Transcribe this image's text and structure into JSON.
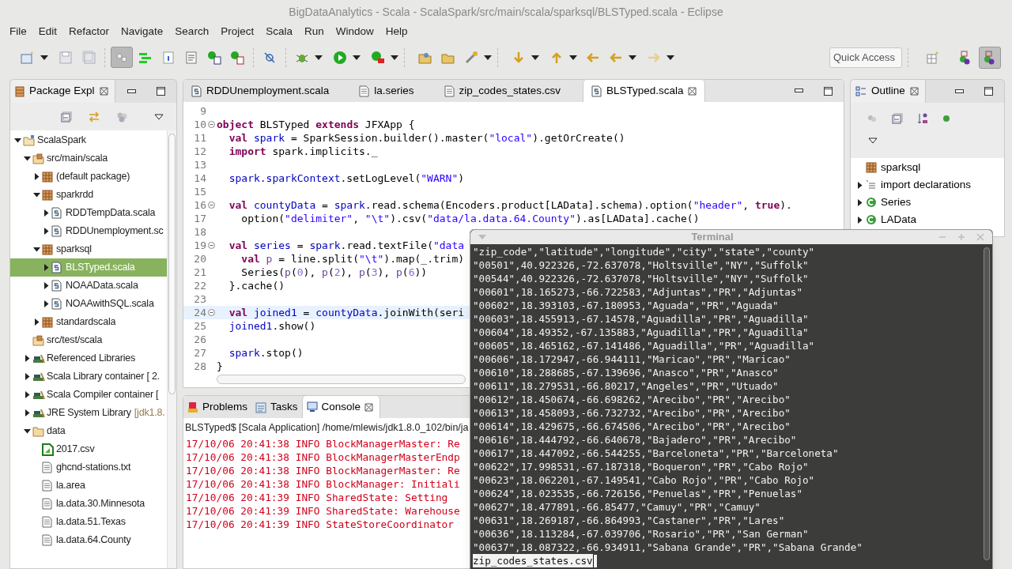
{
  "window": {
    "title": "BigDataAnalytics - Scala - ScalaSpark/src/main/scala/sparksql/BLSTyped.scala - Eclipse"
  },
  "menu": [
    "File",
    "Edit",
    "Refactor",
    "Navigate",
    "Search",
    "Project",
    "Scala",
    "Run",
    "Window",
    "Help"
  ],
  "toolbar": {
    "toggle_pressed": true
  },
  "quick_access": {
    "placeholder": "Quick Access"
  },
  "perspectives": [
    {
      "selected": false
    },
    {
      "selected": true
    }
  ],
  "package_explorer": {
    "tab": "Package Expl",
    "tree": [
      {
        "label": "ScalaSpark",
        "kind": "project",
        "expanded": true,
        "selected": false,
        "children": [
          {
            "label": "src/main/scala",
            "kind": "srcfolder",
            "expanded": true,
            "selected": false,
            "children": [
              {
                "label": "(default package)",
                "kind": "package",
                "expanded": false,
                "selected": false
              },
              {
                "label": "sparkrdd",
                "kind": "package",
                "expanded": true,
                "selected": false,
                "children": [
                  {
                    "label": "RDDTempData.scala",
                    "kind": "scala",
                    "expanded": false,
                    "selected": false
                  },
                  {
                    "label": "RDDUnemployment.sc",
                    "kind": "scala",
                    "expanded": false,
                    "selected": false
                  }
                ]
              },
              {
                "label": "sparksql",
                "kind": "package",
                "expanded": true,
                "selected": false,
                "children": [
                  {
                    "label": "BLSTyped.scala",
                    "kind": "scala",
                    "expanded": false,
                    "selected": true
                  },
                  {
                    "label": "NOAAData.scala",
                    "kind": "scala",
                    "expanded": false,
                    "selected": false
                  },
                  {
                    "label": "NOAAwithSQL.scala",
                    "kind": "scala",
                    "expanded": false,
                    "selected": false
                  }
                ]
              },
              {
                "label": "standardscala",
                "kind": "package",
                "expanded": false,
                "selected": false
              }
            ]
          },
          {
            "label": "src/test/scala",
            "kind": "srcfolder",
            "selected": false
          },
          {
            "label": "Referenced Libraries",
            "kind": "library",
            "expanded": false,
            "selected": false
          },
          {
            "label": "Scala Library container [ 2.",
            "kind": "library",
            "expanded": false,
            "selected": false
          },
          {
            "label": "Scala Compiler container [",
            "kind": "library",
            "expanded": false,
            "selected": false
          },
          {
            "label": "JRE System Library",
            "note": "[jdk1.8.",
            "kind": "library",
            "expanded": false,
            "selected": false
          },
          {
            "label": "data",
            "kind": "folder",
            "expanded": true,
            "selected": false,
            "children": [
              {
                "label": "2017.csv",
                "kind": "csv",
                "selected": false
              },
              {
                "label": "ghcnd-stations.txt",
                "kind": "file",
                "selected": false
              },
              {
                "label": "la.area",
                "kind": "file",
                "selected": false
              },
              {
                "label": "la.data.30.Minnesota",
                "kind": "file",
                "selected": false
              },
              {
                "label": "la.data.51.Texas",
                "kind": "file",
                "selected": false
              },
              {
                "label": "la.data.64.County",
                "kind": "file",
                "selected": false
              }
            ]
          }
        ]
      }
    ]
  },
  "editor": {
    "tabs": [
      {
        "label": "RDDUnemployment.scala",
        "kind": "scala",
        "selected": false
      },
      {
        "label": "la.series",
        "kind": "file",
        "selected": false
      },
      {
        "label": "zip_codes_states.csv",
        "kind": "file",
        "selected": false
      },
      {
        "label": "BLSTyped.scala",
        "kind": "scala",
        "selected": true
      }
    ],
    "lines": [
      {
        "number": "9",
        "fold": false,
        "current": false
      },
      {
        "number": "10",
        "fold": true,
        "current": false,
        "tokens": [
          {
            "t": "object",
            "kind": "kw"
          },
          {
            "t": " BLSTyped ",
            "kind": "plain"
          },
          {
            "t": "extends",
            "kind": "kw"
          },
          {
            "t": " JFXApp {",
            "kind": "plain"
          }
        ]
      },
      {
        "number": "11",
        "fold": false,
        "current": false,
        "tokens": [
          {
            "t": "  val",
            "kind": "kw"
          },
          {
            "t": " spark",
            "kind": "id"
          },
          {
            "t": " = SparkSession.builder().master(",
            "kind": "plain"
          },
          {
            "t": "\"local\"",
            "kind": "str"
          },
          {
            "t": ").getOrCreate()",
            "kind": "plain"
          }
        ]
      },
      {
        "number": "12",
        "fold": false,
        "current": false,
        "tokens": [
          {
            "t": "  import",
            "kind": "kw"
          },
          {
            "t": " spark.implicits._",
            "kind": "plain"
          }
        ]
      },
      {
        "number": "13",
        "fold": false,
        "current": false
      },
      {
        "number": "14",
        "fold": false,
        "current": false,
        "tokens": [
          {
            "t": "  spark.sparkContext",
            "kind": "id"
          },
          {
            "t": ".setLogLevel(",
            "kind": "plain"
          },
          {
            "t": "\"WARN\"",
            "kind": "str"
          },
          {
            "t": ")",
            "kind": "plain"
          }
        ]
      },
      {
        "number": "15",
        "fold": false,
        "current": false
      },
      {
        "number": "16",
        "fold": true,
        "current": false,
        "tokens": [
          {
            "t": "  val",
            "kind": "kw"
          },
          {
            "t": " countyData",
            "kind": "id"
          },
          {
            "t": " = ",
            "kind": "plain"
          },
          {
            "t": "spark",
            "kind": "id"
          },
          {
            "t": ".read.schema(Encoders.product[LAData].schema).option(",
            "kind": "plain"
          },
          {
            "t": "\"header\"",
            "kind": "str"
          },
          {
            "t": ", ",
            "kind": "plain"
          },
          {
            "t": "true",
            "kind": "kw"
          },
          {
            "t": ").",
            "kind": "plain"
          }
        ]
      },
      {
        "number": "17",
        "fold": false,
        "current": false,
        "tokens": [
          {
            "t": "    option(",
            "kind": "plain"
          },
          {
            "t": "\"delimiter\"",
            "kind": "str"
          },
          {
            "t": ", ",
            "kind": "plain"
          },
          {
            "t": "\"\\t\"",
            "kind": "str"
          },
          {
            "t": ").csv(",
            "kind": "plain"
          },
          {
            "t": "\"data/la.data.64.County\"",
            "kind": "str"
          },
          {
            "t": ").as[LAData].cache()",
            "kind": "plain"
          }
        ]
      },
      {
        "number": "18",
        "fold": false,
        "current": false
      },
      {
        "number": "19",
        "fold": true,
        "current": false,
        "tokens": [
          {
            "t": "  val",
            "kind": "kw"
          },
          {
            "t": " series",
            "kind": "id"
          },
          {
            "t": " = ",
            "kind": "plain"
          },
          {
            "t": "spark",
            "kind": "id"
          },
          {
            "t": ".read.textFile(",
            "kind": "plain"
          },
          {
            "t": "\"data",
            "kind": "str"
          }
        ]
      },
      {
        "number": "20",
        "fold": false,
        "current": false,
        "tokens": [
          {
            "t": "    val",
            "kind": "kw"
          },
          {
            "t": " p",
            "kind": "local"
          },
          {
            "t": " = line.split(",
            "kind": "plain"
          },
          {
            "t": "\"\\t\"",
            "kind": "str"
          },
          {
            "t": ").map(_.trim)",
            "kind": "plain"
          }
        ]
      },
      {
        "number": "21",
        "fold": false,
        "current": false,
        "tokens": [
          {
            "t": "    Series(",
            "kind": "plain"
          },
          {
            "t": "p",
            "kind": "local"
          },
          {
            "t": "(",
            "kind": "plain"
          },
          {
            "t": "0",
            "kind": "num"
          },
          {
            "t": "), ",
            "kind": "plain"
          },
          {
            "t": "p",
            "kind": "local"
          },
          {
            "t": "(",
            "kind": "plain"
          },
          {
            "t": "2",
            "kind": "num"
          },
          {
            "t": "), ",
            "kind": "plain"
          },
          {
            "t": "p",
            "kind": "local"
          },
          {
            "t": "(",
            "kind": "plain"
          },
          {
            "t": "3",
            "kind": "num"
          },
          {
            "t": "), ",
            "kind": "plain"
          },
          {
            "t": "p",
            "kind": "local"
          },
          {
            "t": "(",
            "kind": "plain"
          },
          {
            "t": "6",
            "kind": "num"
          },
          {
            "t": "))",
            "kind": "plain"
          }
        ]
      },
      {
        "number": "22",
        "fold": false,
        "current": false,
        "tokens": [
          {
            "t": "  }.cache()",
            "kind": "plain"
          }
        ]
      },
      {
        "number": "23",
        "fold": false,
        "current": false
      },
      {
        "number": "24",
        "fold": true,
        "current": true,
        "tokens": [
          {
            "t": "  val",
            "kind": "kw"
          },
          {
            "t": " joined1",
            "kind": "id"
          },
          {
            "t": " = ",
            "kind": "plain"
          },
          {
            "t": "countyData",
            "kind": "id"
          },
          {
            "t": ".joinWith(seri",
            "kind": "plain"
          }
        ]
      },
      {
        "number": "25",
        "fold": false,
        "current": false,
        "tokens": [
          {
            "t": "  joined1",
            "kind": "id"
          },
          {
            "t": ".show()",
            "kind": "plain"
          }
        ]
      },
      {
        "number": "26",
        "fold": false,
        "current": false
      },
      {
        "number": "27",
        "fold": false,
        "current": false,
        "tokens": [
          {
            "t": "  spark",
            "kind": "id"
          },
          {
            "t": ".stop()",
            "kind": "plain"
          }
        ]
      },
      {
        "number": "28",
        "fold": false,
        "current": false,
        "tokens": [
          {
            "t": "}",
            "kind": "plain"
          }
        ]
      }
    ]
  },
  "console": {
    "tabs": [
      {
        "label": "Problems",
        "kind": "problems",
        "selected": false
      },
      {
        "label": "Tasks",
        "kind": "tasks",
        "selected": false
      },
      {
        "label": "Console",
        "kind": "console",
        "selected": true
      }
    ],
    "header": "BLSTyped$ [Scala Application] /home/mlewis/jdk1.8.0_102/bin/ja",
    "lines": [
      "17/10/06 20:41:38 INFO BlockManagerMaster: Re",
      "17/10/06 20:41:38 INFO BlockManagerMasterEndp",
      "17/10/06 20:41:38 INFO BlockManagerMaster: Re",
      "17/10/06 20:41:38 INFO BlockManager: Initiali",
      "17/10/06 20:41:39 INFO SharedState: Setting",
      "17/10/06 20:41:39 INFO SharedState: Warehouse",
      "17/10/06 20:41:39 INFO StateStoreCoordinator"
    ]
  },
  "outline": {
    "tab": "Outline",
    "items": [
      {
        "label": "sparksql",
        "kind": "package"
      },
      {
        "label": "import declarations",
        "kind": "imports",
        "expanded": false
      },
      {
        "label": "Series",
        "kind": "class",
        "expanded": false
      },
      {
        "label": "LAData",
        "kind": "class",
        "expanded": false
      }
    ]
  },
  "terminal": {
    "title": "Terminal",
    "lines": [
      "\"zip_code\",\"latitude\",\"longitude\",\"city\",\"state\",\"county\"",
      "\"00501\",40.922326,-72.637078,\"Holtsville\",\"NY\",\"Suffolk\"",
      "\"00544\",40.922326,-72.637078,\"Holtsville\",\"NY\",\"Suffolk\"",
      "\"00601\",18.165273,-66.722583,\"Adjuntas\",\"PR\",\"Adjuntas\"",
      "\"00602\",18.393103,-67.180953,\"Aguada\",\"PR\",\"Aguada\"",
      "\"00603\",18.455913,-67.14578,\"Aguadilla\",\"PR\",\"Aguadilla\"",
      "\"00604\",18.49352,-67.135883,\"Aguadilla\",\"PR\",\"Aguadilla\"",
      "\"00605\",18.465162,-67.141486,\"Aguadilla\",\"PR\",\"Aguadilla\"",
      "\"00606\",18.172947,-66.944111,\"Maricao\",\"PR\",\"Maricao\"",
      "\"00610\",18.288685,-67.139696,\"Anasco\",\"PR\",\"Anasco\"",
      "\"00611\",18.279531,-66.80217,\"Angeles\",\"PR\",\"Utuado\"",
      "\"00612\",18.450674,-66.698262,\"Arecibo\",\"PR\",\"Arecibo\"",
      "\"00613\",18.458093,-66.732732,\"Arecibo\",\"PR\",\"Arecibo\"",
      "\"00614\",18.429675,-66.674506,\"Arecibo\",\"PR\",\"Arecibo\"",
      "\"00616\",18.444792,-66.640678,\"Bajadero\",\"PR\",\"Arecibo\"",
      "\"00617\",18.447092,-66.544255,\"Barceloneta\",\"PR\",\"Barceloneta\"",
      "\"00622\",17.998531,-67.187318,\"Boqueron\",\"PR\",\"Cabo Rojo\"",
      "\"00623\",18.062201,-67.149541,\"Cabo Rojo\",\"PR\",\"Cabo Rojo\"",
      "\"00624\",18.023535,-66.726156,\"Penuelas\",\"PR\",\"Penuelas\"",
      "\"00627\",18.477891,-66.85477,\"Camuy\",\"PR\",\"Camuy\"",
      "\"00631\",18.269187,-66.864993,\"Castaner\",\"PR\",\"Lares\"",
      "\"00636\",18.113284,-67.039706,\"Rosario\",\"PR\",\"San German\"",
      "\"00637\",18.087322,-66.934911,\"Sabana Grande\",\"PR\",\"Sabana Grande\""
    ],
    "prompt": "zip_codes_states.csv"
  }
}
